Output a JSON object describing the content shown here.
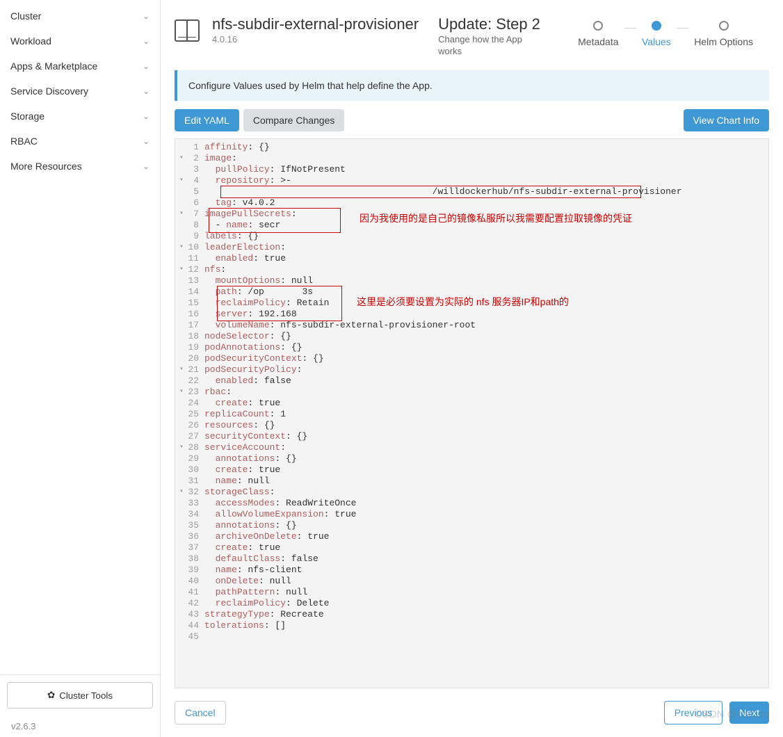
{
  "sidebar": {
    "items": [
      {
        "label": "Cluster"
      },
      {
        "label": "Workload"
      },
      {
        "label": "Apps & Marketplace"
      },
      {
        "label": "Service Discovery"
      },
      {
        "label": "Storage"
      },
      {
        "label": "RBAC"
      },
      {
        "label": "More Resources"
      }
    ],
    "cluster_tools": "Cluster Tools",
    "version": "v2.6.3"
  },
  "header": {
    "title": "nfs-subdir-external-provisioner",
    "subtitle": "4.0.16",
    "step_title": "Update: Step 2",
    "step_desc": "Change how the App works"
  },
  "stepper": {
    "steps": [
      {
        "label": "Metadata"
      },
      {
        "label": "Values",
        "active": true
      },
      {
        "label": "Helm Options"
      }
    ]
  },
  "info_bar": "Configure Values used by Helm that help define the App.",
  "actions": {
    "edit_yaml": "Edit YAML",
    "compare": "Compare Changes",
    "view_chart": "View Chart Info"
  },
  "yaml": {
    "lines": [
      {
        "n": 1,
        "f": "",
        "t": [
          [
            "k",
            "affinity"
          ],
          [
            "v",
            ": {}"
          ]
        ]
      },
      {
        "n": 2,
        "f": "▾",
        "t": [
          [
            "k",
            "image"
          ],
          [
            "v",
            ":"
          ]
        ]
      },
      {
        "n": 3,
        "f": "",
        "t": [
          [
            "v",
            "  "
          ],
          [
            "k",
            "pullPolicy"
          ],
          [
            "v",
            ": IfNotPresent"
          ]
        ]
      },
      {
        "n": 4,
        "f": "▾",
        "t": [
          [
            "v",
            "  "
          ],
          [
            "k",
            "repository"
          ],
          [
            "v",
            ": >-"
          ]
        ]
      },
      {
        "n": 5,
        "f": "",
        "t": [
          [
            "v",
            "                                          "
          ],
          [
            "v",
            "/willdockerhub/nfs-subdir-external-provisioner"
          ]
        ]
      },
      {
        "n": 6,
        "f": "",
        "t": [
          [
            "v",
            "  "
          ],
          [
            "k",
            "tag"
          ],
          [
            "v",
            ": v4.0.2"
          ]
        ]
      },
      {
        "n": 7,
        "f": "▾",
        "t": [
          [
            "k",
            "imagePullSecrets"
          ],
          [
            "v",
            ":"
          ]
        ]
      },
      {
        "n": 8,
        "f": "",
        "t": [
          [
            "v",
            "  - "
          ],
          [
            "k",
            "name"
          ],
          [
            "v",
            ": secr"
          ]
        ]
      },
      {
        "n": 9,
        "f": "",
        "t": [
          [
            "k",
            "labels"
          ],
          [
            "v",
            ": {}"
          ]
        ]
      },
      {
        "n": 10,
        "f": "▾",
        "t": [
          [
            "k",
            "leaderElection"
          ],
          [
            "v",
            ":"
          ]
        ]
      },
      {
        "n": 11,
        "f": "",
        "t": [
          [
            "v",
            "  "
          ],
          [
            "k",
            "enabled"
          ],
          [
            "v",
            ": true"
          ]
        ]
      },
      {
        "n": 12,
        "f": "▾",
        "t": [
          [
            "k",
            "nfs"
          ],
          [
            "v",
            ":"
          ]
        ]
      },
      {
        "n": 13,
        "f": "",
        "t": [
          [
            "v",
            "  "
          ],
          [
            "k",
            "mountOptions"
          ],
          [
            "v",
            ": null"
          ]
        ]
      },
      {
        "n": 14,
        "f": "",
        "t": [
          [
            "v",
            "  "
          ],
          [
            "k",
            "path"
          ],
          [
            "v",
            ": /op       3s"
          ]
        ]
      },
      {
        "n": 15,
        "f": "",
        "t": [
          [
            "v",
            "  "
          ],
          [
            "k",
            "reclaimPolicy"
          ],
          [
            "v",
            ": Retain"
          ]
        ]
      },
      {
        "n": 16,
        "f": "",
        "t": [
          [
            "v",
            "  "
          ],
          [
            "k",
            "server"
          ],
          [
            "v",
            ": 192.168"
          ]
        ]
      },
      {
        "n": 17,
        "f": "",
        "t": [
          [
            "v",
            "  "
          ],
          [
            "k",
            "volumeName"
          ],
          [
            "v",
            ": nfs-subdir-external-provisioner-root"
          ]
        ]
      },
      {
        "n": 18,
        "f": "",
        "t": [
          [
            "k",
            "nodeSelector"
          ],
          [
            "v",
            ": {}"
          ]
        ]
      },
      {
        "n": 19,
        "f": "",
        "t": [
          [
            "k",
            "podAnnotations"
          ],
          [
            "v",
            ": {}"
          ]
        ]
      },
      {
        "n": 20,
        "f": "",
        "t": [
          [
            "k",
            "podSecurityContext"
          ],
          [
            "v",
            ": {}"
          ]
        ]
      },
      {
        "n": 21,
        "f": "▾",
        "t": [
          [
            "k",
            "podSecurityPolicy"
          ],
          [
            "v",
            ":"
          ]
        ]
      },
      {
        "n": 22,
        "f": "",
        "t": [
          [
            "v",
            "  "
          ],
          [
            "k",
            "enabled"
          ],
          [
            "v",
            ": false"
          ]
        ]
      },
      {
        "n": 23,
        "f": "▾",
        "t": [
          [
            "k",
            "rbac"
          ],
          [
            "v",
            ":"
          ]
        ]
      },
      {
        "n": 24,
        "f": "",
        "t": [
          [
            "v",
            "  "
          ],
          [
            "k",
            "create"
          ],
          [
            "v",
            ": true"
          ]
        ]
      },
      {
        "n": 25,
        "f": "",
        "t": [
          [
            "k",
            "replicaCount"
          ],
          [
            "v",
            ": 1"
          ]
        ]
      },
      {
        "n": 26,
        "f": "",
        "t": [
          [
            "k",
            "resources"
          ],
          [
            "v",
            ": {}"
          ]
        ]
      },
      {
        "n": 27,
        "f": "",
        "t": [
          [
            "k",
            "securityContext"
          ],
          [
            "v",
            ": {}"
          ]
        ]
      },
      {
        "n": 28,
        "f": "▾",
        "t": [
          [
            "k",
            "serviceAccount"
          ],
          [
            "v",
            ":"
          ]
        ]
      },
      {
        "n": 29,
        "f": "",
        "t": [
          [
            "v",
            "  "
          ],
          [
            "k",
            "annotations"
          ],
          [
            "v",
            ": {}"
          ]
        ]
      },
      {
        "n": 30,
        "f": "",
        "t": [
          [
            "v",
            "  "
          ],
          [
            "k",
            "create"
          ],
          [
            "v",
            ": true"
          ]
        ]
      },
      {
        "n": 31,
        "f": "",
        "t": [
          [
            "v",
            "  "
          ],
          [
            "k",
            "name"
          ],
          [
            "v",
            ": null"
          ]
        ]
      },
      {
        "n": 32,
        "f": "▾",
        "t": [
          [
            "k",
            "storageClass"
          ],
          [
            "v",
            ":"
          ]
        ]
      },
      {
        "n": 33,
        "f": "",
        "t": [
          [
            "v",
            "  "
          ],
          [
            "k",
            "accessModes"
          ],
          [
            "v",
            ": ReadWriteOnce"
          ]
        ]
      },
      {
        "n": 34,
        "f": "",
        "t": [
          [
            "v",
            "  "
          ],
          [
            "k",
            "allowVolumeExpansion"
          ],
          [
            "v",
            ": true"
          ]
        ]
      },
      {
        "n": 35,
        "f": "",
        "t": [
          [
            "v",
            "  "
          ],
          [
            "k",
            "annotations"
          ],
          [
            "v",
            ": {}"
          ]
        ]
      },
      {
        "n": 36,
        "f": "",
        "t": [
          [
            "v",
            "  "
          ],
          [
            "k",
            "archiveOnDelete"
          ],
          [
            "v",
            ": true"
          ]
        ]
      },
      {
        "n": 37,
        "f": "",
        "t": [
          [
            "v",
            "  "
          ],
          [
            "k",
            "create"
          ],
          [
            "v",
            ": true"
          ]
        ]
      },
      {
        "n": 38,
        "f": "",
        "t": [
          [
            "v",
            "  "
          ],
          [
            "k",
            "defaultClass"
          ],
          [
            "v",
            ": false"
          ]
        ]
      },
      {
        "n": 39,
        "f": "",
        "t": [
          [
            "v",
            "  "
          ],
          [
            "k",
            "name"
          ],
          [
            "v",
            ": nfs-client"
          ]
        ]
      },
      {
        "n": 40,
        "f": "",
        "t": [
          [
            "v",
            "  "
          ],
          [
            "k",
            "onDelete"
          ],
          [
            "v",
            ": null"
          ]
        ]
      },
      {
        "n": 41,
        "f": "",
        "t": [
          [
            "v",
            "  "
          ],
          [
            "k",
            "pathPattern"
          ],
          [
            "v",
            ": null"
          ]
        ]
      },
      {
        "n": 42,
        "f": "",
        "t": [
          [
            "v",
            "  "
          ],
          [
            "k",
            "reclaimPolicy"
          ],
          [
            "v",
            ": Delete"
          ]
        ]
      },
      {
        "n": 43,
        "f": "",
        "t": [
          [
            "k",
            "strategyType"
          ],
          [
            "v",
            ": Recreate"
          ]
        ]
      },
      {
        "n": 44,
        "f": "",
        "t": [
          [
            "k",
            "tolerations"
          ],
          [
            "v",
            ": []"
          ]
        ]
      },
      {
        "n": 45,
        "f": "",
        "t": [
          [
            "v",
            ""
          ]
        ]
      }
    ]
  },
  "annotations": {
    "ann1": "因为我使用的是自己的镜像私服所以我需要配置拉取镜像的凭证",
    "ann2": "这里是必须要设置为实际的 nfs 服务器IP和path的"
  },
  "footer": {
    "cancel": "Cancel",
    "previous": "Previous",
    "next": "Next"
  },
  "watermark": "CSDN @catoop"
}
